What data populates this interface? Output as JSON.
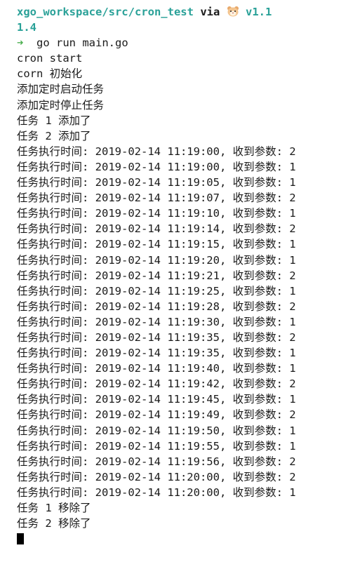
{
  "prompt": {
    "path": "xgo_workspace/src/cron_test",
    "via": "via",
    "version_a": "v1.1",
    "version_b": "1.4",
    "arrow": "➜",
    "command": "go run main.go",
    "icon": "hamster-icon"
  },
  "output": {
    "init_lines": [
      "cron start",
      "corn 初始化",
      "添加定时启动任务",
      "添加定时停止任务",
      "任务 1 添加了",
      "任务 2 添加了"
    ],
    "exec_lines": [
      "任务执行时间: 2019-02-14 11:19:00, 收到参数: 2",
      "任务执行时间: 2019-02-14 11:19:00, 收到参数: 1",
      "任务执行时间: 2019-02-14 11:19:05, 收到参数: 1",
      "任务执行时间: 2019-02-14 11:19:07, 收到参数: 2",
      "任务执行时间: 2019-02-14 11:19:10, 收到参数: 1",
      "任务执行时间: 2019-02-14 11:19:14, 收到参数: 2",
      "任务执行时间: 2019-02-14 11:19:15, 收到参数: 1",
      "任务执行时间: 2019-02-14 11:19:20, 收到参数: 1",
      "任务执行时间: 2019-02-14 11:19:21, 收到参数: 2",
      "任务执行时间: 2019-02-14 11:19:25, 收到参数: 1",
      "任务执行时间: 2019-02-14 11:19:28, 收到参数: 2",
      "任务执行时间: 2019-02-14 11:19:30, 收到参数: 1",
      "任务执行时间: 2019-02-14 11:19:35, 收到参数: 2",
      "任务执行时间: 2019-02-14 11:19:35, 收到参数: 1",
      "任务执行时间: 2019-02-14 11:19:40, 收到参数: 1",
      "任务执行时间: 2019-02-14 11:19:42, 收到参数: 2",
      "任务执行时间: 2019-02-14 11:19:45, 收到参数: 1",
      "任务执行时间: 2019-02-14 11:19:49, 收到参数: 2",
      "任务执行时间: 2019-02-14 11:19:50, 收到参数: 1",
      "任务执行时间: 2019-02-14 11:19:55, 收到参数: 1",
      "任务执行时间: 2019-02-14 11:19:56, 收到参数: 2",
      "任务执行时间: 2019-02-14 11:20:00, 收到参数: 2",
      "任务执行时间: 2019-02-14 11:20:00, 收到参数: 1"
    ],
    "remove_lines": [
      "任务 1 移除了",
      "任务 2 移除了"
    ]
  }
}
